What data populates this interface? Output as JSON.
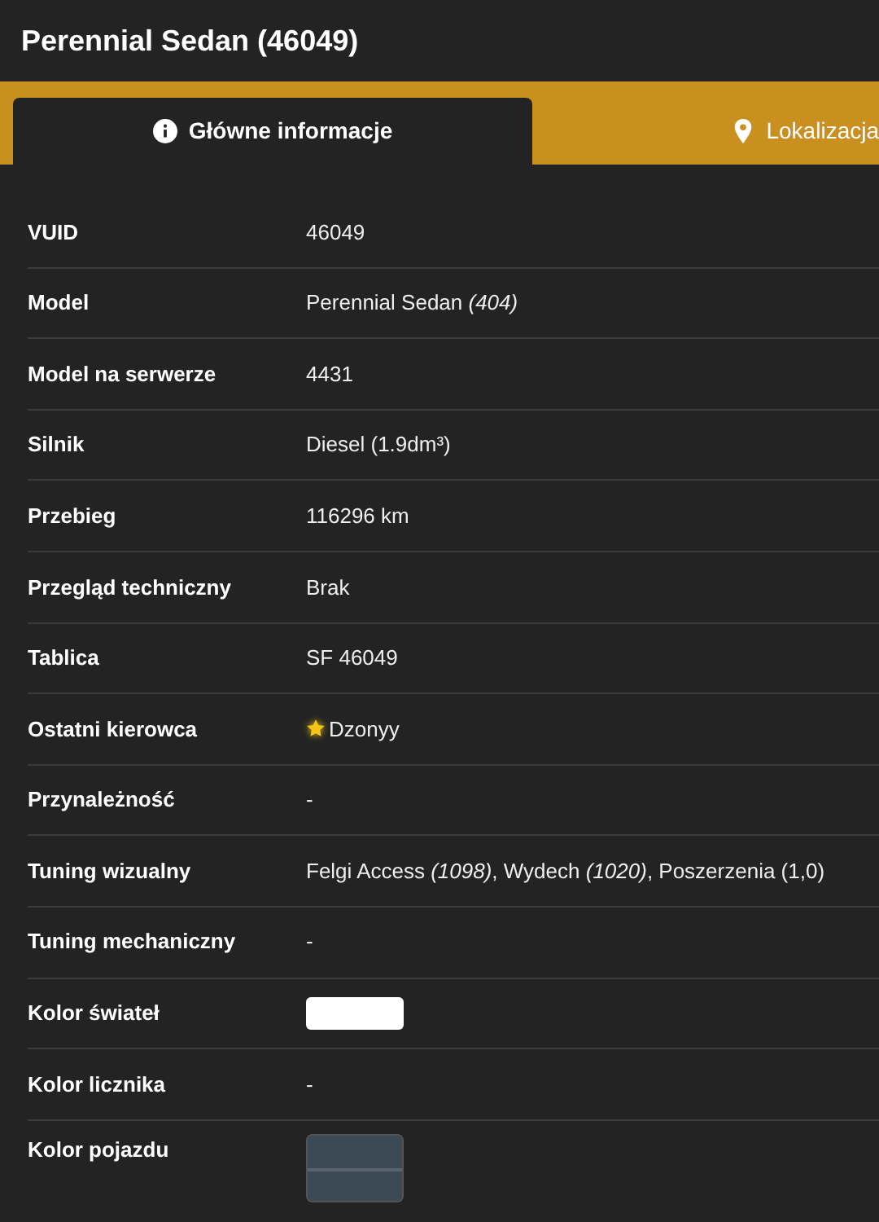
{
  "title": "Perennial Sedan (46049)",
  "tabs": [
    {
      "label": "Główne informacje",
      "kind": "info",
      "selected": true
    },
    {
      "label": "Lokalizacja",
      "kind": "pin",
      "selected": false
    }
  ],
  "rows": [
    {
      "label": "VUID",
      "kind": "text",
      "value": "46049"
    },
    {
      "label": "Model",
      "kind": "text",
      "value": "Perennial Sedan *(404)*"
    },
    {
      "label": "Model na serwerze",
      "kind": "text",
      "value": "4431"
    },
    {
      "label": "Silnik",
      "kind": "text",
      "value": "Diesel (1.9dm³)"
    },
    {
      "label": "Przebieg",
      "kind": "text",
      "value": "116296 km"
    },
    {
      "label": "Przegląd techniczny",
      "kind": "text",
      "value": "Brak"
    },
    {
      "label": "Tablica",
      "kind": "text",
      "value": "SF 46049"
    },
    {
      "label": "Ostatni kierowca",
      "kind": "driver",
      "value": "Dzonyy"
    },
    {
      "label": "Przynależność",
      "kind": "text",
      "value": "-"
    },
    {
      "label": "Tuning wizualny",
      "kind": "text",
      "value": "Felgi Access *(1098)*, Wydech *(1020)*, Poszerzenia (1,0)"
    },
    {
      "label": "Tuning mechaniczny",
      "kind": "text",
      "value": "-"
    },
    {
      "label": "Kolor świateł",
      "kind": "swatch",
      "swatches": [
        {
          "color": "#ffffff"
        }
      ]
    },
    {
      "label": "Kolor licznika",
      "kind": "text",
      "value": "-"
    },
    {
      "label": "Kolor pojazdu",
      "kind": "swatch",
      "swatches": [
        {
          "color": "#3c4a56"
        },
        {
          "color": "#3c4a56"
        }
      ]
    }
  ]
}
